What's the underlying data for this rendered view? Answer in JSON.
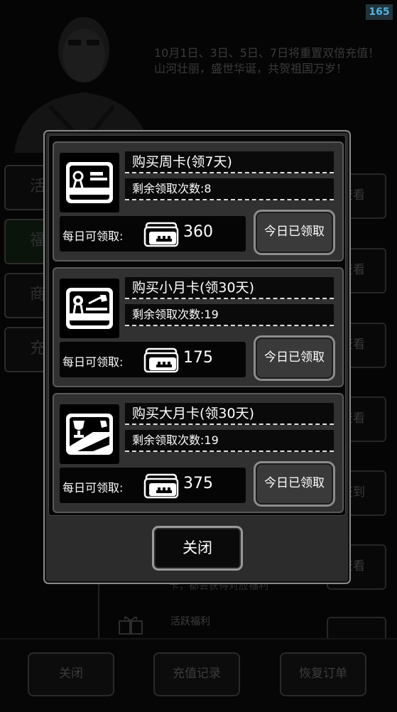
{
  "status": {
    "fps": "165"
  },
  "banner": {
    "text": "10月1日、3日、5日、7日将重置双倍充值！山河壮丽，盛世华诞，共贺祖国万岁！"
  },
  "background": {
    "side_tabs": [
      {
        "label": "活"
      },
      {
        "label": "福"
      },
      {
        "label": "商"
      },
      {
        "label": "充"
      }
    ],
    "right_buttons": [
      {
        "label": "查看"
      },
      {
        "label": "查看"
      },
      {
        "label": "查看"
      },
      {
        "label": "查看"
      },
      {
        "label": "签到"
      },
      {
        "label": "查看"
      },
      {
        "label": ""
      }
    ],
    "desc_fragment": "卡，都会获得对应福利",
    "gift_label": "活跃福利",
    "bottom_buttons": {
      "close": "关闭",
      "recharge_history": "充值记录",
      "restore_orders": "恢复订单"
    }
  },
  "modal": {
    "cards": [
      {
        "icon": "week-card-icon",
        "title": "购买周卡(领7天)",
        "remain": "剩余领取次数:8",
        "daily_label": "每日可领取:",
        "daily_icon": "cash-cards-icon",
        "daily_amount": "360",
        "claim_label": "今日已领取"
      },
      {
        "icon": "small-month-card-icon",
        "title": "购买小月卡(领30天)",
        "remain": "剩余领取次数:19",
        "daily_label": "每日可领取:",
        "daily_icon": "cash-cards-icon",
        "daily_amount": "175",
        "claim_label": "今日已领取"
      },
      {
        "icon": "big-month-card-icon",
        "title": "购买大月卡(领30天)",
        "remain": "剩余领取次数:19",
        "daily_label": "每日可领取:",
        "daily_icon": "cash-cards-icon",
        "daily_amount": "375",
        "claim_label": "今日已领取"
      }
    ],
    "close_label": "关闭"
  }
}
